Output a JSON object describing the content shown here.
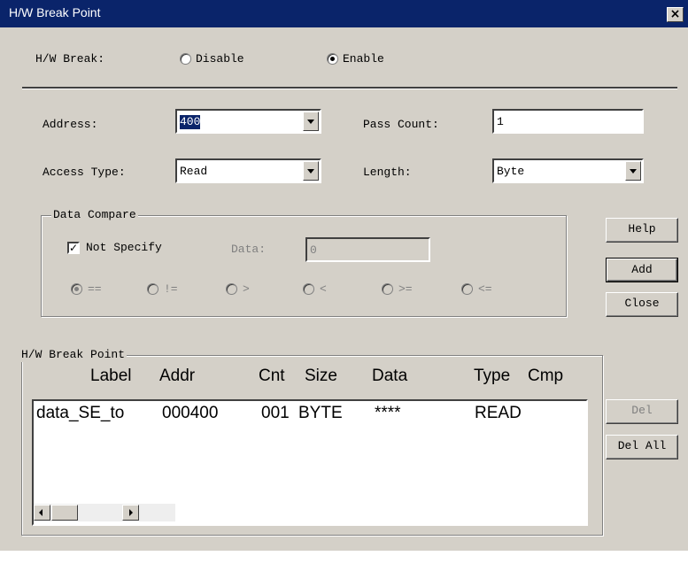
{
  "window": {
    "title": "H/W Break Point",
    "close_glyph": "×"
  },
  "hw_break": {
    "label": "H/W Break:",
    "options": [
      "Disable",
      "Enable"
    ],
    "selected": "Enable"
  },
  "address": {
    "label": "Address:",
    "value": "400"
  },
  "pass_count": {
    "label": "Pass Count:",
    "value": "1"
  },
  "access_type": {
    "label": "Access Type:",
    "value": "Read"
  },
  "length": {
    "label": "Length:",
    "value": "Byte"
  },
  "data_compare": {
    "title": "Data Compare",
    "not_specify_label": "Not Specify",
    "not_specify_checked": true,
    "data_label": "Data:",
    "data_value": "0",
    "operators": [
      "==",
      "!=",
      ">",
      "<",
      ">=",
      "<="
    ],
    "selected_operator": "=="
  },
  "buttons": {
    "help": "Help",
    "add": "Add",
    "close": "Close",
    "del": "Del",
    "del_all": "Del All"
  },
  "breakpoint_list": {
    "title": "H/W Break Point",
    "columns": [
      "Label",
      "Addr",
      "Cnt",
      "Size",
      "Data",
      "Type",
      "Cmp"
    ],
    "rows": [
      {
        "label": "data_SE_to",
        "addr": "000400",
        "cnt": "001",
        "size": "BYTE",
        "data": "****",
        "type": "READ",
        "cmp": ""
      }
    ]
  },
  "icons": [
    "close-icon",
    "dropdown-arrow-icon",
    "scroll-left-icon",
    "scroll-right-icon",
    "checkmark-icon"
  ]
}
